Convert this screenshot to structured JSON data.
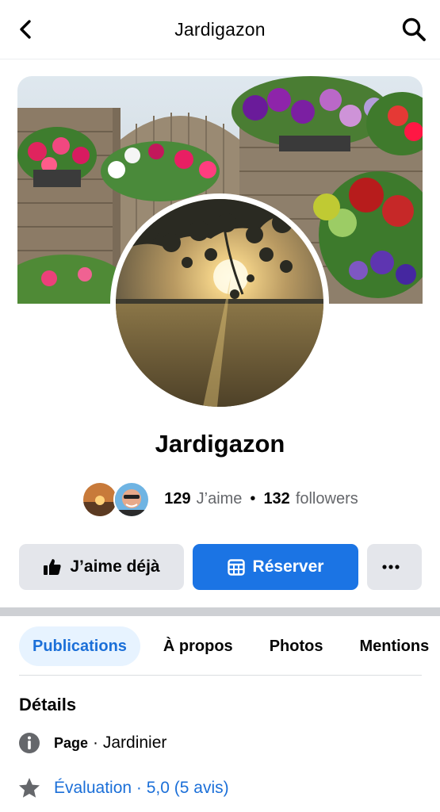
{
  "header": {
    "title": "Jardigazon",
    "back_icon": "chevron-left-icon",
    "search_icon": "search-icon"
  },
  "page": {
    "name": "Jardigazon",
    "likes_count": "129",
    "likes_label": "J’aime",
    "separator": "•",
    "followers_count": "132",
    "followers_label": "followers"
  },
  "actions": {
    "like_label": "J’aime déjà",
    "book_label": "Réserver",
    "more_label": "···"
  },
  "tabs": [
    {
      "label": "Publications",
      "active": true
    },
    {
      "label": "À propos",
      "active": false
    },
    {
      "label": "Photos",
      "active": false
    },
    {
      "label": "Mentions",
      "active": false
    }
  ],
  "details": {
    "title": "Détails",
    "page_key": "Page",
    "page_value": "· Jardinier",
    "rating_text": "Évaluation · 5,0 (5 avis)"
  },
  "colors": {
    "accent": "#1b74e4",
    "tab_active_bg": "#e7f3ff",
    "button_grey": "#e4e6eb"
  }
}
